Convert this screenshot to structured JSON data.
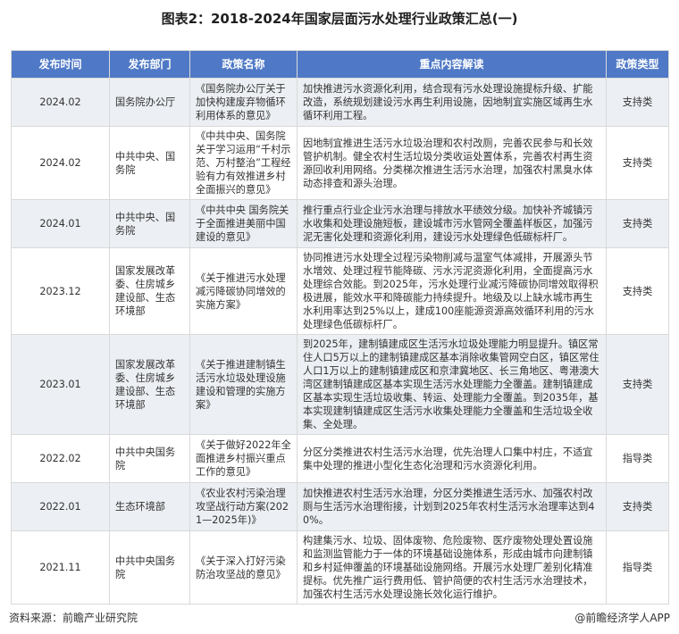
{
  "title": "图表2：2018-2024年国家层面污水处理行业政策汇总(一)",
  "columns": [
    "发布时间",
    "发布部门",
    "政策名称",
    "重点内容解读",
    "政策类型"
  ],
  "rows": [
    {
      "date": "2024.02",
      "dept": "国务院办公厅",
      "name": "《国务院办公厅关于加快构建废弃物循环利用体系的意见》",
      "content": "加快推进污水资源化利用，结合现有污水处理设施提标升级、扩能改造，系统规划建设污水再生利用设施，因地制宜实施区域再生水循环利用工程。",
      "type": "支持类"
    },
    {
      "date": "2024.02",
      "dept": "中共中央、国务院",
      "name": "《中共中央、国务院关于学习运用“千村示范、万村整治”工程经验有力有效推进乡村全面振兴的意见》",
      "content": "因地制宜推进生活污水垃圾治理和农村改厕，完善农民参与和长效管护机制。健全农村生活垃圾分类收运处置体系，完善农村再生资源回收利用网络。分类梯次推进生活污水治理，加强农村黑臭水体动态排查和源头治理。",
      "type": "支持类"
    },
    {
      "date": "2024.01",
      "dept": "中共中央、国务院",
      "name": "《中共中央 国务院关于全面推进美丽中国建设的意见》",
      "content": "推行重点行业企业污水治理与排放水平绩效分级。加快补齐城镇污水收集和处理设施短板，建设城市污水管网全覆盖样板区，加强污泥无害化处理和资源化利用，建设污水处理绿色低碳标杆厂。",
      "type": "支持类"
    },
    {
      "date": "2023.12",
      "dept": "国家发展改革委、住房城乡建设部、生态环境部",
      "name": "《关于推进污水处理减污降碳协同增效的实施方案》",
      "content": "协同推进污水处理全过程污染物削减与温室气体减排，开展源头节水增效、处理过程节能降碳、污水污泥资源化利用，全面提高污水处理综合效能。到2025年，污水处理行业减污降碳协同增效取得积极进展，能效水平和降碳能力持续提升。地级及以上缺水城市再生水利用率达到25%以上，建成100座能源资源高效循环利用的污水处理绿色低碳标杆厂。",
      "type": "支持类"
    },
    {
      "date": "2023.01",
      "dept": "国家发展改革委、住房城乡建设部、生态环境部",
      "name": "《关于推进建制镇生活污水垃圾处理设施建设和管理的实施方案》",
      "content": "到2025年，建制镇建成区生活污水垃圾处理能力明显提升。镇区常住人口5万以上的建制镇建成区基本消除收集管网空白区，镇区常住人口1万以上的建制镇建成区和京津冀地区、长三角地区、粤港澳大湾区建制镇建成区基本实现生活污水处理能力全覆盖。建制镇建成区基本实现生活垃圾收集、转运、处理能力全覆盖。到2035年，基本实现建制镇建成区生活污水收集处理能力全覆盖和生活垃圾全收集、全处理。",
      "type": "支持类"
    },
    {
      "date": "2022.02",
      "dept": "中共中央国务院",
      "name": "《关于做好2022年全面推进乡村振兴重点工作的意见》",
      "content": "分区分类推进农村生活污水治理，优先治理人口集中村庄，不适宜集中处理的推进小型化生态化治理和污水资源化利用。",
      "type": "指导类"
    },
    {
      "date": "2022.01",
      "dept": "生态环境部",
      "name": "《农业农村污染治理攻坚战行动方案(2021—2025年)》",
      "content": "加快推进农村生活污水治理，分区分类推进生活污水、加强农村改厕与生活污水治理衔接，计划到2025年农村生活污水治理率达到40%。",
      "type": "支持类"
    },
    {
      "date": "2021.11",
      "dept": "中共中央国务院",
      "name": "《关于深入打好污染防治攻坚战的意见》",
      "content": "构建集污水、垃圾、固体废物、危险废物、医疗废物处理处置设施和监测监管能力于一体的环境基础设施体系，形成由城市向建制镇和乡村延伸覆盖的环境基础设施网络。开展污水处理厂差别化精准提标。优先推广运行费用低、管护简便的农村生活污水治理技术，加强农村生活污水处理设施长效化运行维护。",
      "type": "指导类"
    }
  ],
  "footer": {
    "source": "资料来源：前瞻产业研究院",
    "brand": "@前瞻经济学人APP"
  }
}
